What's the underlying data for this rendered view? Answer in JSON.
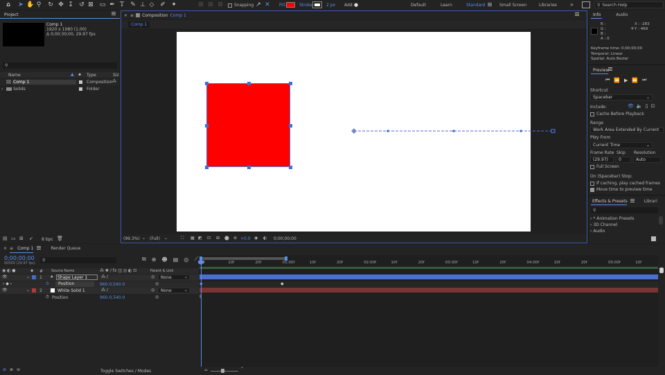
{
  "toolbar": {
    "snapping_label": "Snapping",
    "fill_label": "Fill:",
    "stroke_label": "Stroke:",
    "stroke_width": "2 px",
    "add_label": "Add:",
    "workspaces": [
      "Default",
      "Learn",
      "Standard",
      "Small Screen",
      "Libraries"
    ],
    "active_workspace": "Standard",
    "search_help": "Search Help",
    "fill_color": "#ff0000"
  },
  "project": {
    "title": "Project",
    "comp_name": "Comp 1",
    "comp_dims": "1920 x 1080 (1.00)",
    "comp_duration": "Δ 0;00;30;00, 29.97 fps",
    "search_placeholder": "",
    "col_name": "Name",
    "col_type": "Type",
    "col_size": "Siz",
    "items": [
      {
        "name": "Comp 1",
        "type": "Composition"
      },
      {
        "name": "Solids",
        "type": "Folder"
      }
    ],
    "bpc": "8 bpc"
  },
  "composition": {
    "tab_label": "Composition",
    "tab_comp": "Comp 1",
    "sub_tab": "Comp 1",
    "zoom": "(99.3%)",
    "resolution": "(Full)",
    "exposure": "+0.0",
    "timecode": "0;00;00;00"
  },
  "info": {
    "tab_info": "Info",
    "tab_audio": "Audio",
    "r": "R :",
    "g": "G :",
    "b": "B :",
    "a": "A :  0",
    "x": "X : -283",
    "y": "Y : 469",
    "keyframe_time": "Keyframe time: 0;00;00;00",
    "temporal": "Temporal: Linear",
    "spatial": "Spatial: Auto Bezier"
  },
  "preview": {
    "title": "Preview",
    "shortcut_label": "Shortcut",
    "shortcut_value": "Spacebar",
    "include_label": "Include:",
    "cache_before": "Cache Before Playback",
    "range_label": "Range",
    "range_value": "Work Area Extended By Current ...",
    "play_from_label": "Play From",
    "play_from_value": "Current Time",
    "frame_rate_label": "Frame Rate",
    "skip_label": "Skip",
    "resolution_label": "Resolution",
    "frame_rate_value": "(29.97)",
    "skip_value": "0",
    "resolution_value": "Auto",
    "full_screen": "Full Screen",
    "on_stop_label": "On (Spacebar) Stop:",
    "if_caching": "If caching, play cached frames",
    "move_time": "Move time to preview time"
  },
  "effects": {
    "tab_effects": "Effects & Presets",
    "tab_libraries": "Librari",
    "search_placeholder": "",
    "items": [
      "* Animation Presets",
      "3D Channel",
      "Audio"
    ]
  },
  "timeline": {
    "tab_comp": "Comp 1",
    "tab_render": "Render Queue",
    "current_time": "0;00;00;00",
    "fps_sub": "00000 (29.97 fps)",
    "col_num": "#",
    "col_source": "Source Name",
    "col_parent": "Parent & Link",
    "ruler": [
      "0f",
      "10f",
      "20f",
      "01:00f",
      "10f",
      "20f",
      "02:00f",
      "10f",
      "20f",
      "03:00f",
      "10f",
      "20f",
      "04:00f",
      "10f",
      "20f",
      "05:00f",
      "10f"
    ],
    "layers": [
      {
        "num": "1",
        "name": "Shape Layer 1",
        "parent": "None",
        "label_color": "#3e6ec9",
        "bar_color": "#4a6fd2"
      },
      {
        "num": "2",
        "name": "White Solid 1",
        "parent": "None",
        "label_color": "#b03a3a",
        "bar_color": "#7a3434"
      }
    ],
    "properties": [
      {
        "name": "Position",
        "value": "960.0,540.0"
      },
      {
        "name": "Position",
        "value": "960.0,540.0"
      }
    ],
    "toggle_label": "Toggle Switches / Modes"
  }
}
